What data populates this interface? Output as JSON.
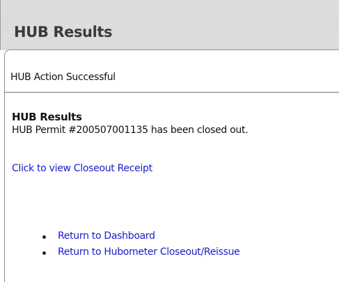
{
  "header": {
    "title": "HUB Results"
  },
  "status": {
    "message": "HUB Action Successful"
  },
  "results": {
    "heading": "HUB Results",
    "message": "HUB Permit #200507001135 has been closed out.",
    "receipt_link": "Click to view Closeout Receipt"
  },
  "nav": {
    "items": [
      {
        "label": "Return to Dashboard"
      },
      {
        "label": "Return to Hubometer Closeout/Reissue"
      }
    ]
  },
  "colors": {
    "link": "#1a1acc",
    "title_text": "#3a3a3a",
    "body_text": "#111111"
  }
}
